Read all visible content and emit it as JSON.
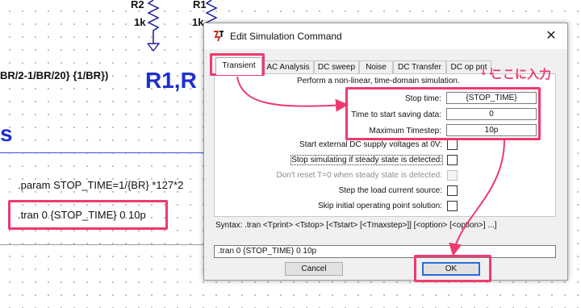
{
  "schematic": {
    "resistors": [
      {
        "ref": "R2",
        "value": "1k"
      },
      {
        "ref": "R1",
        "value": "1k"
      }
    ],
    "expr_text": "BR/2-1/BR/20} {1/BR})",
    "big_label": "R1,R",
    "small_label": "s",
    "param_directive": ".param STOP_TIME=1/{BR} *127*2",
    "tran_directive": ".tran 0 {STOP_TIME} 0 10p"
  },
  "annotation": {
    "text": "ここに入力",
    "arrows": "↓↓",
    "color": "#ee3a6d"
  },
  "dialog": {
    "title": "Edit Simulation Command",
    "close_glyph": "✕",
    "tabs": [
      {
        "label": "Transient",
        "active": true
      },
      {
        "label": "AC Analysis",
        "active": false
      },
      {
        "label": "DC sweep",
        "active": false
      },
      {
        "label": "Noise",
        "active": false
      },
      {
        "label": "DC Transfer",
        "active": false
      },
      {
        "label": "DC op pnt",
        "active": false
      }
    ],
    "description": "Perform a non-linear, time-domain simulation.",
    "fields": [
      {
        "label": "Stop time:",
        "value": "{STOP_TIME}"
      },
      {
        "label": "Time to start saving data:",
        "value": "0"
      },
      {
        "label": "Maximum Timestep:",
        "value": "10p"
      }
    ],
    "checkboxes": [
      {
        "label": "Start external DC supply voltages at 0V:",
        "checked": false,
        "disabled": false
      },
      {
        "label": "Stop simulating if steady state is detected:",
        "checked": false,
        "disabled": false
      },
      {
        "label": "Don't reset T=0 when steady state is detected:",
        "checked": false,
        "disabled": true
      },
      {
        "label": "Step the load current source:",
        "checked": false,
        "disabled": false
      },
      {
        "label": "Skip initial operating point solution:",
        "checked": false,
        "disabled": false
      }
    ],
    "syntax": "Syntax:  .tran <Tprint> <Tstop> [<Tstart> [<Tmaxstep>]] [<option> [<option>] ...]",
    "command": ".tran 0 {STOP_TIME} 0 10p",
    "cancel_label": "Cancel",
    "ok_label": "OK"
  },
  "colors": {
    "highlight": "#ee3a6d",
    "schematic_blue": "#1d2fd0",
    "ok_border": "#2a6ad8"
  }
}
